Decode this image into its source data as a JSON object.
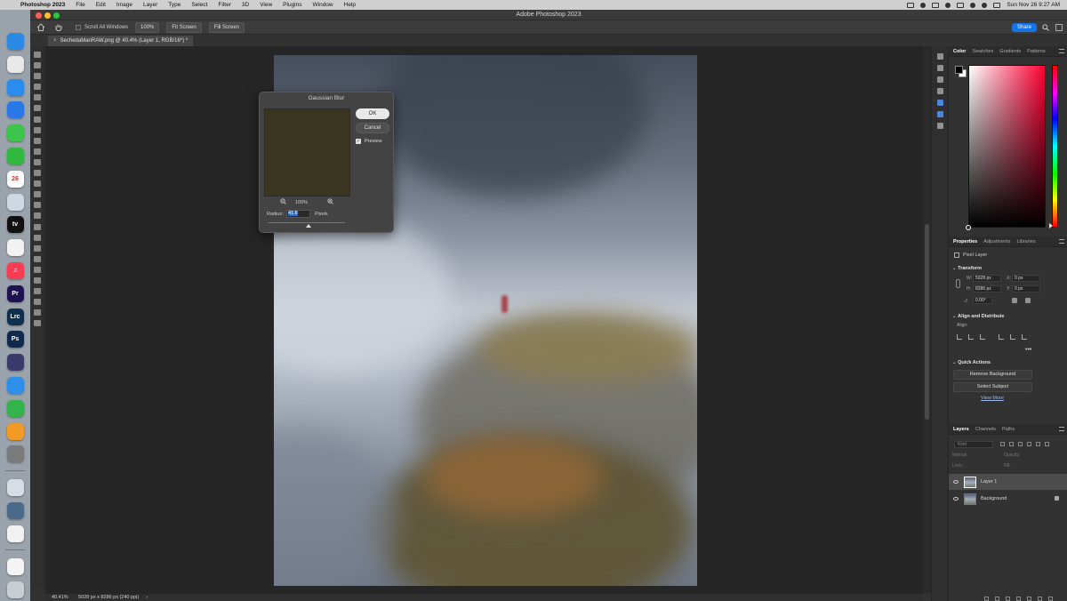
{
  "menubar": {
    "app_name": "Photoshop 2023",
    "menus": [
      "File",
      "Edit",
      "Image",
      "Layer",
      "Type",
      "Select",
      "Filter",
      "3D",
      "View",
      "Plugins",
      "Window",
      "Help"
    ],
    "clock": "Sun Nov 26  9:27 AM"
  },
  "window": {
    "title": "Adobe Photoshop 2023",
    "traffic_colors": [
      "#ff5f57",
      "#febc2e",
      "#28c840"
    ]
  },
  "options_bar": {
    "scroll_all_windows_label": "Scroll All Windows",
    "zoom_100_label": "100%",
    "fit_screen_label": "Fit Screen",
    "fill_screen_label": "Fill Screen",
    "share_label": "Share"
  },
  "document": {
    "tab_label": "SechedaManRAW.png @ 40.4% (Layer 1, RGB/16*) *",
    "tab_close": "×"
  },
  "status_bar": {
    "zoom": "40.41%",
    "dimensions": "5028 px x 8286 px (240 ppi)",
    "arrow": "›"
  },
  "dock": {
    "calendar_day": "26",
    "apps": [
      {
        "name": "finder-icon",
        "label": "",
        "color": "#2a8ae6"
      },
      {
        "name": "chrome-icon",
        "label": "",
        "color": "#e8e8e8"
      },
      {
        "name": "mail-icon",
        "label": "",
        "color": "#2b8cf0"
      },
      {
        "name": "app-store-icon",
        "label": "",
        "color": "#2a77e8"
      },
      {
        "name": "messages-icon",
        "label": "",
        "color": "#3cc44b"
      },
      {
        "name": "facetime-icon",
        "label": "",
        "color": "#2fba3f"
      },
      {
        "name": "calendar-icon",
        "label": "26",
        "color": "#ffffff"
      },
      {
        "name": "weather-icon",
        "label": "",
        "color": "#cfd8e2"
      },
      {
        "name": "apple-tv-icon",
        "label": "tv",
        "color": "#111111"
      },
      {
        "name": "reminders-icon",
        "label": "",
        "color": "#f2f2f2"
      },
      {
        "name": "music-icon",
        "label": "♫",
        "color": "#fa3c53"
      },
      {
        "name": "premiere-pro-icon",
        "label": "Pr",
        "color": "#1f1250"
      },
      {
        "name": "lightroom-classic-icon",
        "label": "Lrc",
        "color": "#0f2f4f"
      },
      {
        "name": "photoshop-icon",
        "label": "Ps",
        "color": "#0f2a4d"
      },
      {
        "name": "davinci-resolve-icon",
        "label": "",
        "color": "#3b3b6b"
      },
      {
        "name": "keynote-icon",
        "label": "",
        "color": "#2d8fe8"
      },
      {
        "name": "numbers-icon",
        "label": "",
        "color": "#34b34a"
      },
      {
        "name": "pages-icon",
        "label": "",
        "color": "#f29a26"
      },
      {
        "name": "system-settings-icon",
        "label": "",
        "color": "#7a7a7a"
      },
      {
        "name": "preview-icon",
        "label": "",
        "color": "#d7dde5"
      },
      {
        "name": "quicktime-icon",
        "label": "",
        "color": "#4a6a8a"
      },
      {
        "name": "photos-icon",
        "label": "",
        "color": "#f1f1f1"
      },
      {
        "name": "document-icon",
        "label": "",
        "color": "#f4f4f4"
      },
      {
        "name": "trash-icon",
        "label": "",
        "color": "#c9ced3"
      }
    ]
  },
  "panels": {
    "color_tabs": [
      "Color",
      "Swatches",
      "Gradients",
      "Patterns"
    ],
    "properties_tabs": [
      "Properties",
      "Adjustments",
      "Libraries"
    ],
    "pixel_layer_label": "Pixel Layer",
    "transform": {
      "title": "Transform",
      "w_label": "W:",
      "w_value": "5028 px",
      "h_label": "H:",
      "h_value": "8286 px",
      "x_label": "X:",
      "x_value": "0 px",
      "y_label": "Y:",
      "y_value": "0 px",
      "angle_value": "0.00°"
    },
    "align": {
      "title": "Align and Distribute",
      "align_label": "Align:",
      "more": "•••"
    },
    "quick_actions": {
      "title": "Quick Actions",
      "remove_bg": "Remove Background",
      "select_subject": "Select Subject",
      "view_more": "View More"
    },
    "layers_tabs": [
      "Layers",
      "Channels",
      "Paths"
    ],
    "layers_search_placeholder": "Kind",
    "blend_mode": "Normal",
    "opacity_label": "Opacity:",
    "lock_label": "Lock:",
    "fill_label": "Fill:",
    "layers": [
      {
        "name": "Layer 1",
        "selected": true,
        "locked": false
      },
      {
        "name": "Background",
        "selected": false,
        "locked": true
      }
    ]
  },
  "gaussian_blur": {
    "title": "Gaussian Blur",
    "ok_label": "OK",
    "cancel_label": "Cancel",
    "preview_label": "Preview",
    "preview_checked": true,
    "zoom_label": "100%",
    "radius_label": "Radius:",
    "radius_value": "41.6",
    "radius_unit": "Pixels",
    "preview_color": "#3a3521"
  }
}
